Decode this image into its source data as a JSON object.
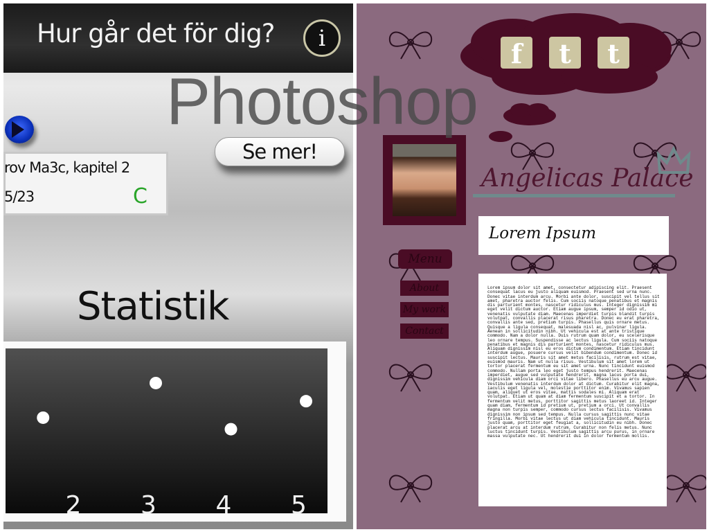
{
  "left_app": {
    "header": {
      "title": "Hur går det för dig?",
      "info_icon": "info-icon",
      "info_label": "i"
    },
    "see_more_label": "Se mer!",
    "course": {
      "name": "rov Ma3c, kapitel 2",
      "score": "5/23",
      "grade": "C"
    },
    "stats_title": "Statistik",
    "chart_data": {
      "type": "scatter",
      "x_tick_labels": [
        "2",
        "3",
        "4",
        "5"
      ],
      "points": [
        {
          "x": 1.5,
          "y": 0.58
        },
        {
          "x": 3,
          "y": 0.79
        },
        {
          "x": 4,
          "y": 0.51
        },
        {
          "x": 5,
          "y": 0.68
        }
      ],
      "grid": false
    },
    "colors": {
      "grade_green": "#2aa52a",
      "blue_button": "#1e40d8"
    }
  },
  "right_site": {
    "social": {
      "facebook": "f",
      "twitter": "t",
      "tumblr": "t"
    },
    "brand": "Angelicas Palace",
    "heading": "Lorem Ipsum",
    "menu": {
      "title": "Menu",
      "items": [
        "About",
        "My work",
        "Contact"
      ]
    },
    "body_text": "Lorem ipsum dolor sit amet, consectetur adipiscing elit. Praesent consequat lacus eu justo aliquam euismod. Praesent sed urna nunc. Donec vitae interdum arcu. Morbi ante dolor, suscipit vel tellus sit amet, pharetra auctor felis. Cum sociis natoque penatibus et magnis dis parturient montes, nascetur ridiculus mus. Integer dignissim mi eget velit dictum auctor. Etiam augue ipsum, semper id odio ut, venenatis vulputate diam. Maecenas imperdiet turpis blandit turpis volutpat, convallis placerat risus pharetra. Donec eu erat pharetra, convallis ante sed, pretium turpis. Phasellus quis ornare metus. Quisque a ligula consequat, malesuada nisl ac, pulvinar ligula. Aenean in sollicitudin nibh. Ut vehicula est at ante tristique commodo. Nam a dolor nulla. Duis rutrum quam dolor, eu scelerisque leo ornare tempus. Suspendisse ac lectus ligula. Cum sociis natoque penatibus et magnis dis parturient montes, nascetur ridiculus mus. Aliquam dignissim nisl eu eros dictum condimentum. Etiam tincidunt interdum augue, posuere cursus velit bibendum condimentum. Donec id suscipit lectus. Mauris sit amet metus facilisis, rutrum est vitae, euismod mauris. Nam ut nulla risus. Vestibulum sit amet lorem ut tortor placerat fermentum eu sit amet urna. Nunc tincidunt euismod commodo. Nullam porta leo eget justo tempus hendrerit. Maecenas imperdiet, augue sed vulputate hendrerit, magna lacus porta dui, dignissim vehicula diam orci vitae libero. Phasellus eu arcu augue. Vestibulum venenatis interdum dolor at dictum. Curabitur elit magna, iaculis eget ligula vel, molestie porttitor enim. Vivamus sapien quam, aliquet ut eros vitae, mattis sodales mi. Aliquam erat volutpat. Etiam ut quam at diam fermentum suscipit et a tortor. In fermentum velit metus, porttitor sagittis metus laoreet id. Integer quam diam, fermentum id pretium ut, pretium a orci. Ut convallis magna non turpis semper, commodo cursus lectus facilisis. Vivamus dignissim non ipsum sed tempus. Nulla cursus sagittis nunc vitae fringilla. Morbi vitae lectus ut diam vehicula tincidunt. Mauris justo quam, porttitor eget feugiat a, sollicitudin eu nibh. Donec placerat arcu at interdum rutrum. Curabitur non felis metus. Nunc luctus tincidunt turpis. Vestibulum sagittis arcu purus, in ornare massa vulputate nec. Ut hendrerit dui in dolor fermentum mollis.",
    "colors": {
      "background": "#8b6a7f",
      "dark_plum": "#4a0c25",
      "social_tile": "#cdc6a2"
    }
  },
  "watermark": "Photoshop"
}
